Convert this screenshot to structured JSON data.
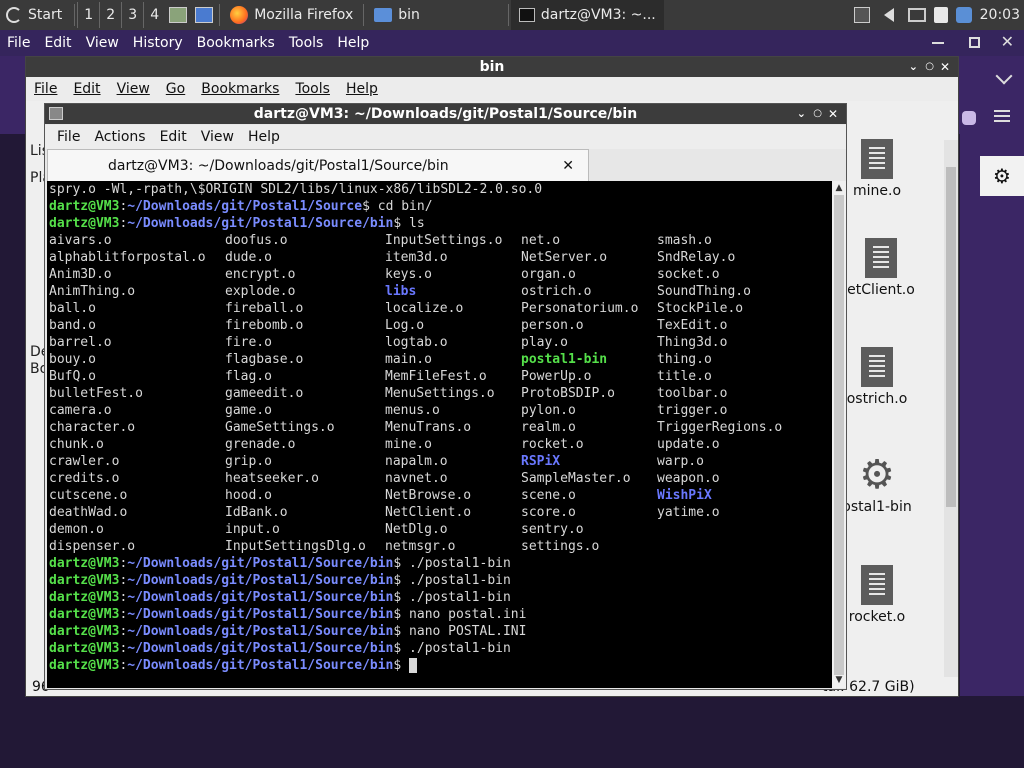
{
  "taskbar": {
    "start_label": "Start",
    "workspaces": [
      "1",
      "2",
      "3",
      "4"
    ],
    "tasks": [
      {
        "label": "Mozilla Firefox",
        "icon": "firefox-icon"
      },
      {
        "label": "bin",
        "icon": "folder-icon"
      },
      {
        "label": "dartz@VM3: ~...",
        "icon": "terminal-icon"
      }
    ],
    "clock": "20:03"
  },
  "firefox": {
    "menu": [
      "File",
      "Edit",
      "View",
      "History",
      "Bookmarks",
      "Tools",
      "Help"
    ]
  },
  "filemanager": {
    "title": "bin",
    "menu": [
      "File",
      "Edit",
      "View",
      "Go",
      "Bookmarks",
      "Tools",
      "Help"
    ],
    "side_fragments": [
      "Lis",
      "Pla",
      "De",
      "Bo"
    ],
    "icons": [
      {
        "label": "mine.o",
        "kind": "doc"
      },
      {
        "label": "etClient.o",
        "kind": "doc"
      },
      {
        "label": "ostrich.o",
        "kind": "doc"
      },
      {
        "label": "ostal1-bin",
        "kind": "gear"
      },
      {
        "label": "rocket.o",
        "kind": "doc"
      }
    ],
    "status_left": "96",
    "status_right": "tal: 62.7 GiB)"
  },
  "terminal": {
    "title": "dartz@VM3: ~/Downloads/git/Postal1/Source/bin",
    "menu": [
      "File",
      "Actions",
      "Edit",
      "View",
      "Help"
    ],
    "tab_label": "dartz@VM3: ~/Downloads/git/Postal1/Source/bin",
    "prompt_user": "dartz@VM3",
    "prompt_path_source": "~/Downloads/git/Postal1/Source",
    "prompt_path_bin": "~/Downloads/git/Postal1/Source/bin",
    "first_line": "spry.o -Wl,-rpath,\\$ORIGIN SDL2/libs/linux-x86/libSDL2-2.0.so.0",
    "cmd_cd": "cd bin/",
    "cmd_ls": "ls",
    "ls_rows": [
      [
        "aivars.o",
        "doofus.o",
        "InputSettings.o",
        "net.o",
        "smash.o"
      ],
      [
        "alphablitforpostal.o",
        "dude.o",
        "item3d.o",
        "NetServer.o",
        "SndRelay.o"
      ],
      [
        "Anim3D.o",
        "encrypt.o",
        "keys.o",
        "organ.o",
        "socket.o"
      ],
      [
        "AnimThing.o",
        "explode.o",
        "libs",
        "ostrich.o",
        "SoundThing.o"
      ],
      [
        "ball.o",
        "fireball.o",
        "localize.o",
        "Personatorium.o",
        "StockPile.o"
      ],
      [
        "band.o",
        "firebomb.o",
        "Log.o",
        "person.o",
        "TexEdit.o"
      ],
      [
        "barrel.o",
        "fire.o",
        "logtab.o",
        "play.o",
        "Thing3d.o"
      ],
      [
        "bouy.o",
        "flagbase.o",
        "main.o",
        "postal1-bin",
        "thing.o"
      ],
      [
        "BufQ.o",
        "flag.o",
        "MemFileFest.o",
        "PowerUp.o",
        "title.o"
      ],
      [
        "bulletFest.o",
        "gameedit.o",
        "MenuSettings.o",
        "ProtoBSDIP.o",
        "toolbar.o"
      ],
      [
        "camera.o",
        "game.o",
        "menus.o",
        "pylon.o",
        "trigger.o"
      ],
      [
        "character.o",
        "GameSettings.o",
        "MenuTrans.o",
        "realm.o",
        "TriggerRegions.o"
      ],
      [
        "chunk.o",
        "grenade.o",
        "mine.o",
        "rocket.o",
        "update.o"
      ],
      [
        "crawler.o",
        "grip.o",
        "napalm.o",
        "RSPiX",
        "warp.o"
      ],
      [
        "credits.o",
        "heatseeker.o",
        "navnet.o",
        "SampleMaster.o",
        "weapon.o"
      ],
      [
        "cutscene.o",
        "hood.o",
        "NetBrowse.o",
        "scene.o",
        "WishPiX"
      ],
      [
        "deathWad.o",
        "IdBank.o",
        "NetClient.o",
        "score.o",
        "yatime.o"
      ],
      [
        "demon.o",
        "input.o",
        "NetDlg.o",
        "sentry.o",
        ""
      ],
      [
        "dispenser.o",
        "InputSettingsDlg.o",
        "netmsgr.o",
        "settings.o",
        ""
      ]
    ],
    "dir_entries": [
      "libs",
      "RSPiX",
      "WishPiX"
    ],
    "exe_entries": [
      "postal1-bin"
    ],
    "history": [
      "./postal1-bin",
      "./postal1-bin",
      "./postal1-bin",
      "nano postal.ini",
      "nano POSTAL.INI",
      "./postal1-bin"
    ]
  },
  "colors": {
    "prompt_user": "#55e04a",
    "prompt_path": "#7a8cff",
    "firefox_purple": "#3b2665"
  }
}
